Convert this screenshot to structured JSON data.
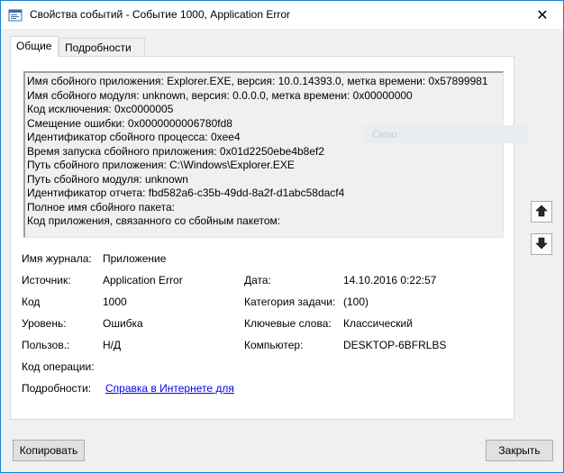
{
  "window": {
    "title": "Свойства событий - Событие 1000, Application Error",
    "close_glyph": "✕"
  },
  "tabs": [
    {
      "label": "Общие",
      "active": true
    },
    {
      "label": "Подробности",
      "active": false
    }
  ],
  "description_lines": [
    "Имя сбойного приложения: Explorer.EXE, версия: 10.0.14393.0, метка времени: 0x57899981",
    "Имя сбойного модуля: unknown, версия: 0.0.0.0, метка времени: 0x00000000",
    "Код исключения: 0xc0000005",
    "Смещение ошибки: 0x0000000006780fd8",
    "Идентификатор сбойного процесса: 0xee4",
    "Время запуска сбойного приложения: 0x01d2250ebe4b8ef2",
    "Путь сбойного приложения: C:\\Windows\\Explorer.EXE",
    "Путь сбойного модуля: unknown",
    "Идентификатор отчета: fbd582a6-c35b-49dd-8a2f-d1abc58dacf4",
    "Полное имя сбойного пакета:",
    "Код приложения, связанного со сбойным пакетом:"
  ],
  "ghost_label": "Окно",
  "fields": {
    "log_name_label": "Имя журнала:",
    "log_name_value": "Приложение",
    "source_label": "Источник:",
    "source_value": "Application Error",
    "date_label": "Дата:",
    "date_value": "14.10.2016 0:22:57",
    "code_label": "Код",
    "code_value": "1000",
    "task_category_label": "Категория задачи:",
    "task_category_value": "(100)",
    "level_label": "Уровень:",
    "level_value": "Ошибка",
    "keywords_label": "Ключевые слова:",
    "keywords_value": "Классический",
    "user_label": "Пользов.:",
    "user_value": "Н/Д",
    "computer_label": "Компьютер:",
    "computer_value": "DESKTOP-6BFRLBS",
    "opcode_label": "Код операции:",
    "details_label": "Подробности:",
    "details_link": "Справка в Интернете для"
  },
  "buttons": {
    "copy": "Копировать",
    "close": "Закрыть"
  },
  "icons": {
    "up_arrow": "arrow-up-icon",
    "down_arrow": "arrow-down-icon",
    "app": "event-viewer-icon"
  }
}
